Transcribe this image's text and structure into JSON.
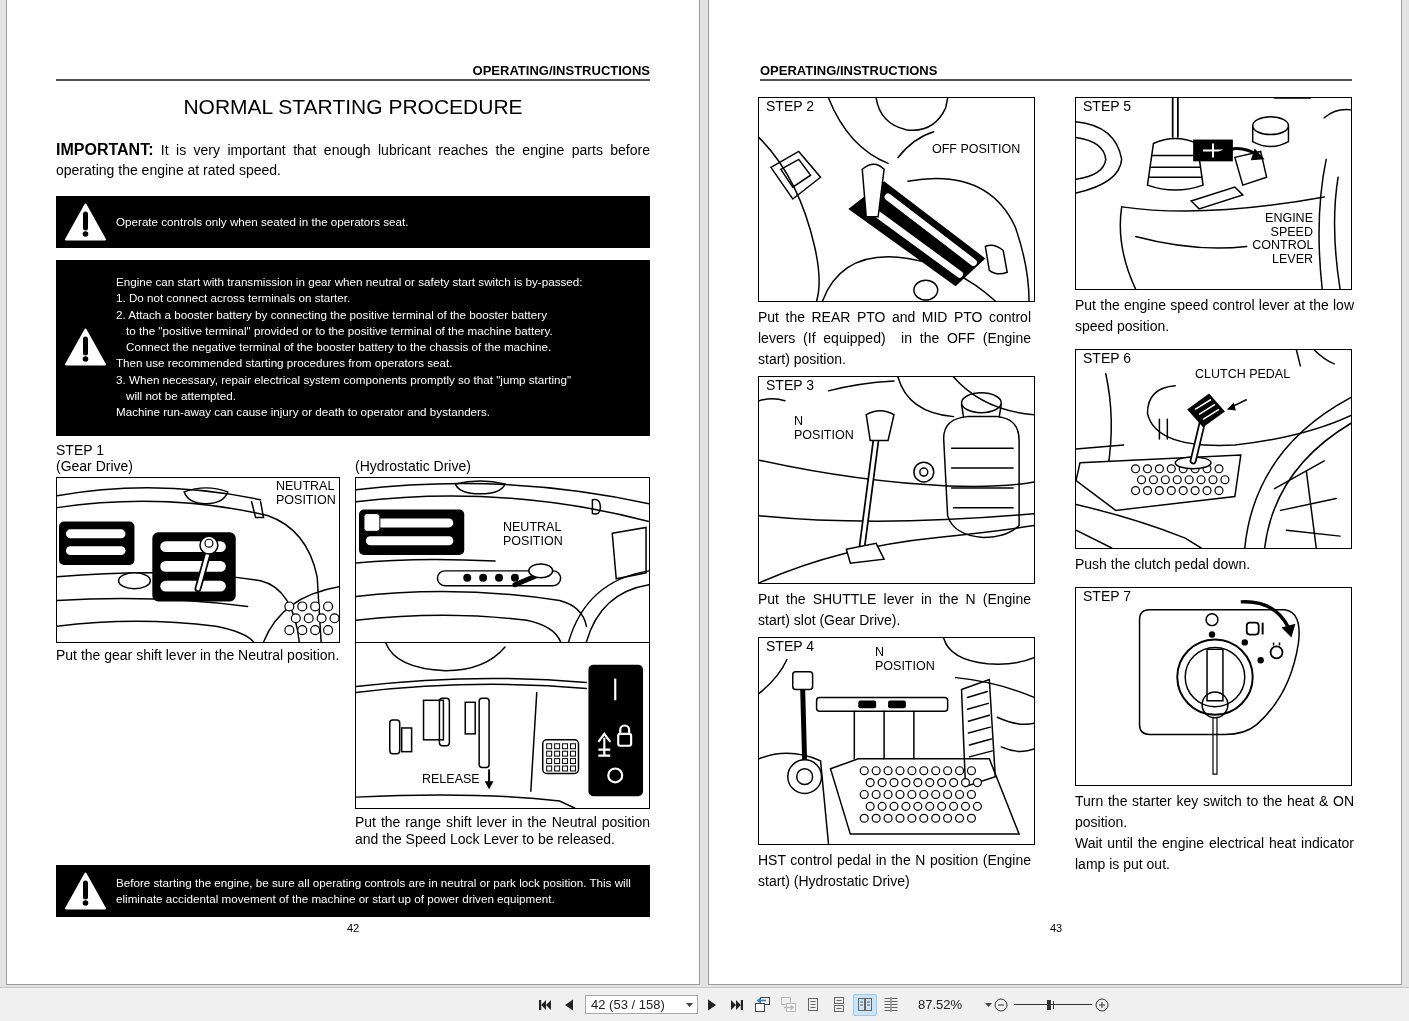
{
  "left_page": {
    "header": "OPERATING/INSTRUCTIONS",
    "title": "NORMAL STARTING PROCEDURE",
    "important": "**IMPORTANT:** It is very important that enough lubricant reaches the engine parts before operating the engine at rated speed.",
    "warnings": [
      {
        "kind": "text",
        "text": "Operate controls only when seated in the operators seat."
      },
      {
        "kind": "list",
        "paragraphs": [
          {
            "lines": [
              "Engine can start with transmission in gear when neutral or safety start switch is by-passed:"
            ]
          },
          {
            "lines": [
              "1. Do not connect across terminals on starter."
            ]
          },
          {
            "lines": [
              "2. Attach a booster battery by connecting the positive terminal of the booster battery",
              "to the \"positive terminal\" provided or to the positive terminal of the machine battery.",
              "Connect the negative terminal of the booster battery to the chassis of the machine."
            ]
          },
          {
            "lines": [
              "Then use recommended starting procedures from operators seat."
            ]
          },
          {
            "lines": [
              "3. When necessary, repair electrical system components promptly so that \"jump starting\"",
              "will not be attempted."
            ]
          },
          {
            "lines": [
              "Machine run-away can cause injury or death to operator and bystanders."
            ]
          }
        ]
      }
    ],
    "step": {
      "label": "STEP 1",
      "figures": [
        {
          "subtitle": "(Gear Drive)",
          "panels": [
            {
              "callouts": [
                "NEUTRAL POSITION"
              ]
            }
          ],
          "caption": [
            "Put the gear shift lever in the Neutral position."
          ]
        },
        {
          "subtitle": "(Hydrostatic Drive)",
          "panels": [
            {
              "callouts": [
                "NEUTRAL POSITION"
              ]
            },
            {
              "callouts": [
                "RELEASE"
              ]
            }
          ],
          "caption": [
            "Put the range shift lever in the Neutral position and the Speed Lock Lever to be released."
          ]
        }
      ]
    },
    "bottom_warning": {
      "kind": "text",
      "text": "Before starting the engine, be sure all operating controls are in neutral or park lock position. This will eliminate accidental movement of the machine or start up of power driven equipment."
    },
    "page_number": "42"
  },
  "right_page": {
    "header": "OPERATING/INSTRUCTIONS",
    "columns": [
      {
        "steps": [
          {
            "label": "STEP 2",
            "callouts": [
              "OFF POSITION"
            ],
            "caption": [
              "Put the REAR PTO and MID PTO control levers (If equipped)  in the OFF (Engine start) position."
            ]
          },
          {
            "label": "STEP 3",
            "callouts": [
              "N POSITION"
            ],
            "caption": [
              "Put the SHUTTLE lever in the N (Engine start) slot (Gear Drive)."
            ]
          },
          {
            "label": "STEP 4",
            "callouts": [
              "N POSITION"
            ],
            "caption": [
              "HST control pedal in the N position (Engine start) (Hydrostatic Drive)"
            ]
          }
        ]
      },
      {
        "steps": [
          {
            "label": "STEP 5",
            "callouts": [
              "ENGINE SPEED CONTROL LEVER"
            ],
            "caption": [
              "Put the engine speed control lever at the low speed position."
            ]
          },
          {
            "label": "STEP 6",
            "callouts": [
              "CLUTCH PEDAL"
            ],
            "caption": [
              "Push the clutch pedal down."
            ]
          },
          {
            "label": "STEP 7",
            "caption": [
              "Turn the starter key switch to the heat & ON position.",
              "Wait until the engine electrical heat indicator lamp is put out."
            ]
          }
        ]
      }
    ],
    "page_number": "43"
  },
  "toolbar": {
    "page_field": {
      "value": "42 (53 / 158)"
    },
    "history_buttons": [
      {
        "disabled": false
      },
      {
        "disabled": true
      }
    ],
    "view_modes": [
      {
        "selected": false
      },
      {
        "selected": false
      },
      {
        "selected": true
      },
      {
        "selected": false
      }
    ],
    "zoom": {
      "value": "87.52%",
      "level": 0.45
    }
  }
}
